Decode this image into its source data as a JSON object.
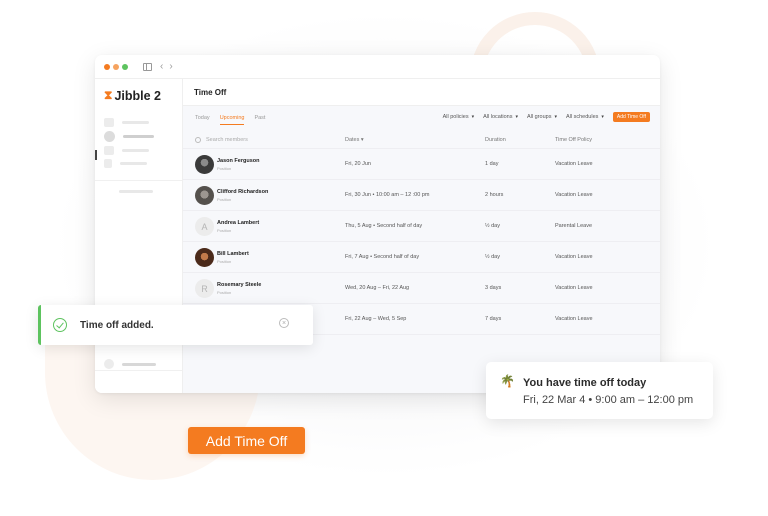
{
  "colors": {
    "accent": "#f47b20",
    "success": "#5dc35f",
    "window_dots": [
      "#f47b20",
      "#f6a35f",
      "#5dc35f"
    ]
  },
  "window": {
    "nav_back": "‹",
    "nav_forward": "›"
  },
  "sidebar": {
    "logo_mark": "⧗",
    "logo_text": "Jibble 2"
  },
  "header": {
    "title": "Time Off"
  },
  "tabs": [
    {
      "label": "Today",
      "active": false
    },
    {
      "label": "Upcoming",
      "active": true
    },
    {
      "label": "Past",
      "active": false
    }
  ],
  "filters": [
    {
      "label": "All policies",
      "caret": "▾"
    },
    {
      "label": "All locations",
      "caret": "▾"
    },
    {
      "label": "All groups",
      "caret": "▾"
    },
    {
      "label": "All schedules",
      "caret": "▾"
    }
  ],
  "add_time_off_small": "Add Time Off",
  "table": {
    "search_placeholder": "Search members",
    "columns": {
      "dates": "Dates ▾",
      "duration": "Duration",
      "policy": "Time Off Policy"
    },
    "rows": [
      {
        "name": "Jason Ferguson",
        "position": "Position",
        "avatar": "",
        "dates": "Fri, 20 Jun",
        "duration": "1 day",
        "policy": "Vacation Leave"
      },
      {
        "name": "Clifford Richardson",
        "position": "Position",
        "avatar": "",
        "dates": "Fri, 30 Jun • 10:00 am – 12 :00 pm",
        "duration": "2 hours",
        "policy": "Vacation Leave"
      },
      {
        "name": "Andrea Lambert",
        "position": "Position",
        "avatar": "A",
        "dates": "Thu, 5 Aug • Second half of day",
        "duration": "½ day",
        "policy": "Parental Leave"
      },
      {
        "name": "Bill Lambert",
        "position": "Position",
        "avatar": "",
        "dates": "Fri, 7 Aug • Second half of day",
        "duration": "½ day",
        "policy": "Vacation Leave"
      },
      {
        "name": "Rosemary Steele",
        "position": "Position",
        "avatar": "R",
        "dates": "Wed, 20 Aug – Fri, 22 Aug",
        "duration": "3 days",
        "policy": "Vacation Leave"
      },
      {
        "name": "",
        "position": "",
        "avatar": "",
        "dates": "Fri, 22 Aug – Wed, 5 Sep",
        "duration": "7 days",
        "policy": "Vacation Leave"
      }
    ]
  },
  "toast": {
    "message": "Time off added.",
    "close_glyph": "×"
  },
  "time_off_card": {
    "icon": "palm-tree",
    "icon_glyph": "🌴",
    "title": "You have time off today",
    "subtitle": "Fri, 22 Mar 4 • 9:00 am – 12:00 pm"
  },
  "add_time_off_large": "Add Time Off"
}
